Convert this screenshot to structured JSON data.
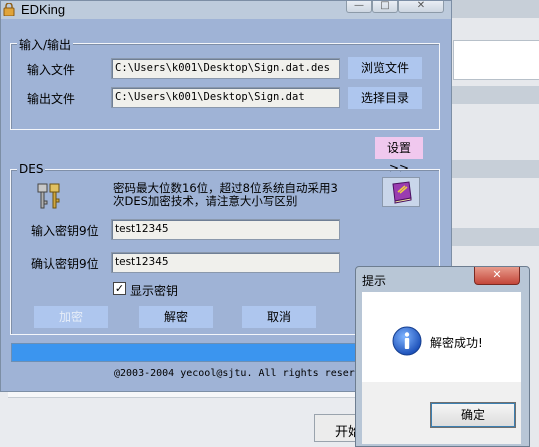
{
  "app": {
    "title": "EDKing"
  },
  "window_controls": {
    "minimize": "—",
    "maximize": "□",
    "close": "✕"
  },
  "io_group": {
    "legend": "输入/输出",
    "input_label": "输入文件",
    "input_value": "C:\\Users\\k001\\Desktop\\Sign.dat.des",
    "browse_button": "浏览文件",
    "output_label": "输出文件",
    "output_value": "C:\\Users\\k001\\Desktop\\Sign.dat",
    "choose_dir_button": "选择目录"
  },
  "settings_button": "设置 >>",
  "des_group": {
    "legend": "DES",
    "note": "密码最大位数16位，超过8位系统自动采用3次DES加密技术，请注意大小写区别",
    "key_label": "输入密钥9位",
    "key_value": "test12345",
    "confirm_label": "确认密钥9位",
    "confirm_value": "test12345",
    "show_key_label": "显示密钥",
    "show_key_checked": true,
    "encrypt_button": "加密",
    "decrypt_button": "解密",
    "cancel_button": "取消"
  },
  "progress": {
    "percent": 100
  },
  "copyright": "@2003-2004 yecool@sjtu. All rights reserved",
  "dialog": {
    "title": "提示",
    "close": "✕",
    "message": "解密成功!",
    "ok_button": "确定"
  },
  "background_window": {
    "start_button": "开始"
  },
  "icons": {
    "app": "lock-icon",
    "keys": "keys-icon",
    "book": "book-icon",
    "info": "info-icon"
  }
}
